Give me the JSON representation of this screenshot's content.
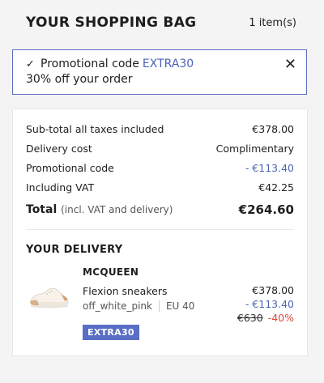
{
  "header": {
    "title": "YOUR SHOPPING BAG",
    "item_count": "1 item(s)"
  },
  "promo": {
    "label": "Promotional code",
    "code": "EXTRA30",
    "description": "30% off your order",
    "check_icon": "✓",
    "close_icon": "✕"
  },
  "summary": {
    "rows": [
      {
        "label": "Sub-total all taxes included",
        "value": "€378.00"
      },
      {
        "label": "Delivery cost",
        "value": "Complimentary"
      },
      {
        "label": "Promotional code",
        "value": "- €113.40"
      },
      {
        "label": "Including VAT",
        "value": "€42.25"
      }
    ],
    "total_label": "Total",
    "total_note": "(incl. VAT and delivery)",
    "total_value": "€264.60"
  },
  "delivery": {
    "title": "YOUR DELIVERY",
    "item": {
      "brand": "MCQUEEN",
      "name": "Flexion sneakers",
      "color": "off_white_pink",
      "size": "EU 40",
      "badge": "EXTRA30",
      "price": "€378.00",
      "discount": "- €113.40",
      "original_price": "€630",
      "percent_off": "-40%"
    }
  },
  "colors": {
    "accent": "#4d63b7",
    "badge": "#5a6ec5",
    "sale_red": "#d94a3a"
  }
}
